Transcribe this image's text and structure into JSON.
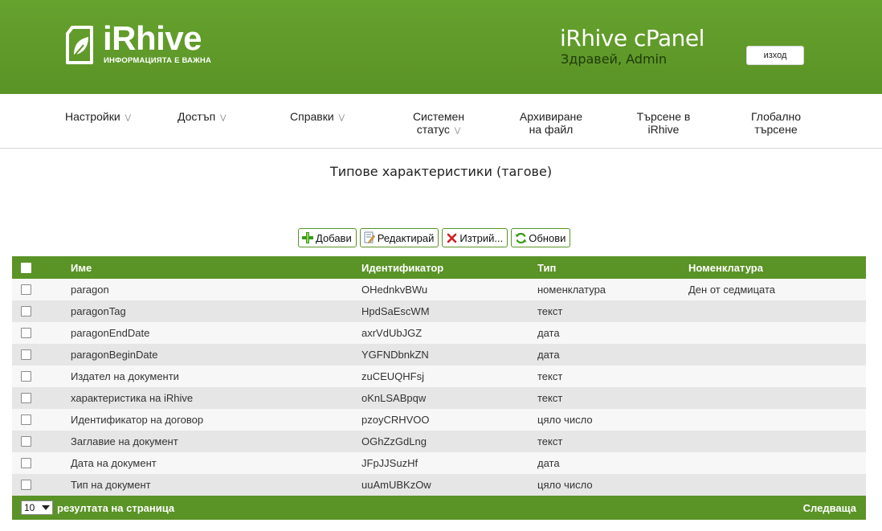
{
  "header": {
    "logo_text": "iRhive",
    "logo_tagline": "ИНФОРМАЦИЯТА Е ВАЖНА",
    "cpanel_title": "iRhive cPanel",
    "greeting": "Здравей, Admin",
    "logout_label": "изход"
  },
  "nav": {
    "items": [
      {
        "label": "Настройки",
        "line2": "",
        "has_menu": true
      },
      {
        "label": "Достъп",
        "line2": "",
        "has_menu": true
      },
      {
        "label": "Справки",
        "line2": "",
        "has_menu": true
      },
      {
        "label": "Системен",
        "line2": "статус",
        "has_menu": true
      },
      {
        "label": "Архивиране",
        "line2": "на файл",
        "has_menu": false
      },
      {
        "label": "Търсене в",
        "line2": "iRhive",
        "has_menu": false
      },
      {
        "label": "Глобално",
        "line2": "търсене",
        "has_menu": false
      }
    ]
  },
  "page": {
    "title": "Типове характеристики (тагове)"
  },
  "toolbar": {
    "add_label": "Добави",
    "edit_label": "Редактирай",
    "delete_label": "Изтрий...",
    "refresh_label": "Обнови"
  },
  "table": {
    "columns": [
      "Име",
      "Идентификатор",
      "Тип",
      "Номенклатура"
    ],
    "rows": [
      {
        "name": "paragon",
        "id": "OHednkvBWu",
        "type": "номенклатура",
        "nomenclature": "Ден от седмицата"
      },
      {
        "name": "paragonTag",
        "id": "HpdSaEscWM",
        "type": "текст",
        "nomenclature": ""
      },
      {
        "name": "paragonEndDate",
        "id": "axrVdUbJGZ",
        "type": "дата",
        "nomenclature": ""
      },
      {
        "name": "paragonBeginDate",
        "id": "YGFNDbnkZN",
        "type": "дата",
        "nomenclature": ""
      },
      {
        "name": "Издател на документи",
        "id": "zuCEUQHFsj",
        "type": "текст",
        "nomenclature": ""
      },
      {
        "name": "характеристика на iRhive",
        "id": "oKnLSABpqw",
        "type": "текст",
        "nomenclature": ""
      },
      {
        "name": "Идентификатор на договор",
        "id": "pzoyCRHVOO",
        "type": "цяло число",
        "nomenclature": ""
      },
      {
        "name": "Заглавие на документ",
        "id": "OGhZzGdLng",
        "type": "текст",
        "nomenclature": ""
      },
      {
        "name": "Дата на документ",
        "id": "JFpJJSuzHf",
        "type": "дата",
        "nomenclature": ""
      },
      {
        "name": "Тип на документ",
        "id": "uuAmUBKzOw",
        "type": "цяло число",
        "nomenclature": ""
      }
    ]
  },
  "pager": {
    "page_size": "10",
    "page_size_label": "резултата на страница",
    "next_label": "Следваща"
  },
  "colors": {
    "brand_green": "#5a9326",
    "row_odd": "#f7f7f7",
    "row_even": "#e6e6e6"
  }
}
